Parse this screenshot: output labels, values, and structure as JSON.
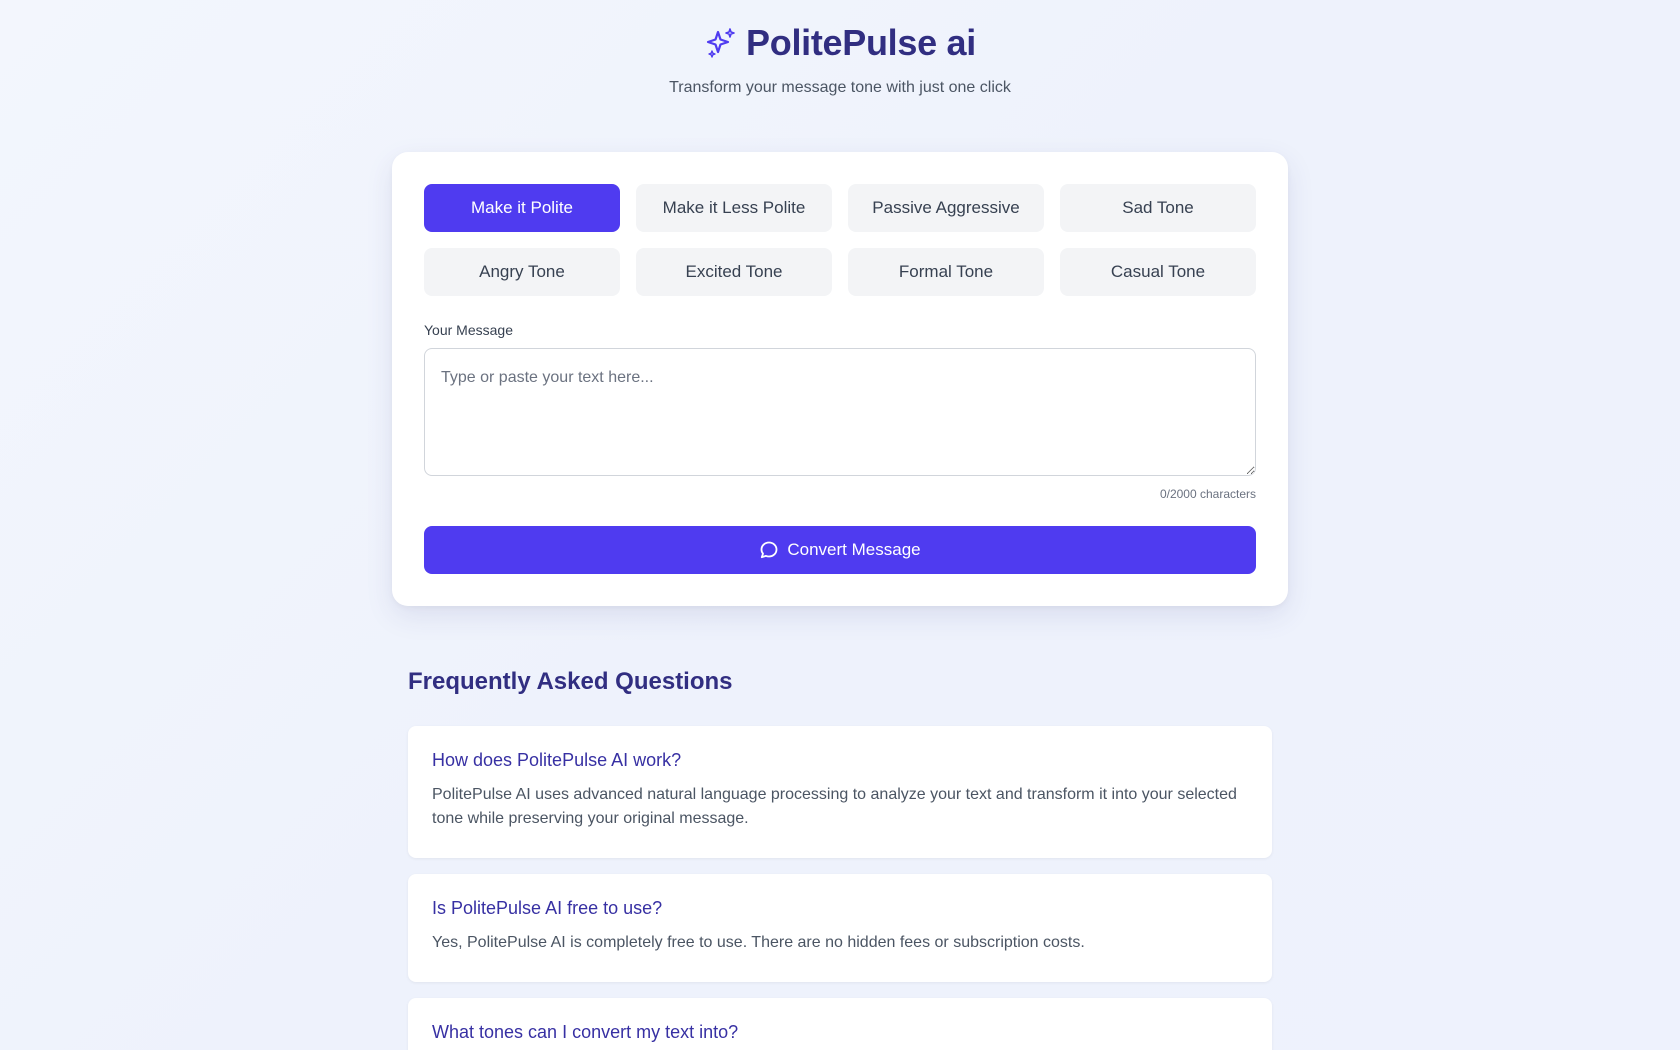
{
  "header": {
    "title": "PolitePulse ai",
    "icon": "sparkles-icon",
    "tagline": "Transform your message tone with just one click"
  },
  "tones": [
    {
      "label": "Make it Polite",
      "active": true
    },
    {
      "label": "Make it Less Polite",
      "active": false
    },
    {
      "label": "Passive Aggressive",
      "active": false
    },
    {
      "label": "Sad Tone",
      "active": false
    },
    {
      "label": "Angry Tone",
      "active": false
    },
    {
      "label": "Excited Tone",
      "active": false
    },
    {
      "label": "Formal Tone",
      "active": false
    },
    {
      "label": "Casual Tone",
      "active": false
    }
  ],
  "message": {
    "label": "Your Message",
    "placeholder": "Type or paste your text here...",
    "value": "",
    "char_count": "0/2000 characters"
  },
  "convert_button": {
    "label": "Convert Message",
    "icon": "chat-bubble-icon"
  },
  "faq": {
    "title": "Frequently Asked Questions",
    "items": [
      {
        "question": "How does PolitePulse AI work?",
        "answer": "PolitePulse AI uses advanced natural language processing to analyze your text and transform it into your selected tone while preserving your original message."
      },
      {
        "question": "Is PolitePulse AI free to use?",
        "answer": "Yes, PolitePulse AI is completely free to use. There are no hidden fees or subscription costs."
      },
      {
        "question": "What tones can I convert my text into?",
        "answer": ""
      }
    ]
  },
  "colors": {
    "accent": "#4f3bf0",
    "heading": "#312e81",
    "question": "#3730a3",
    "inactive_button": "#f3f4f6"
  }
}
